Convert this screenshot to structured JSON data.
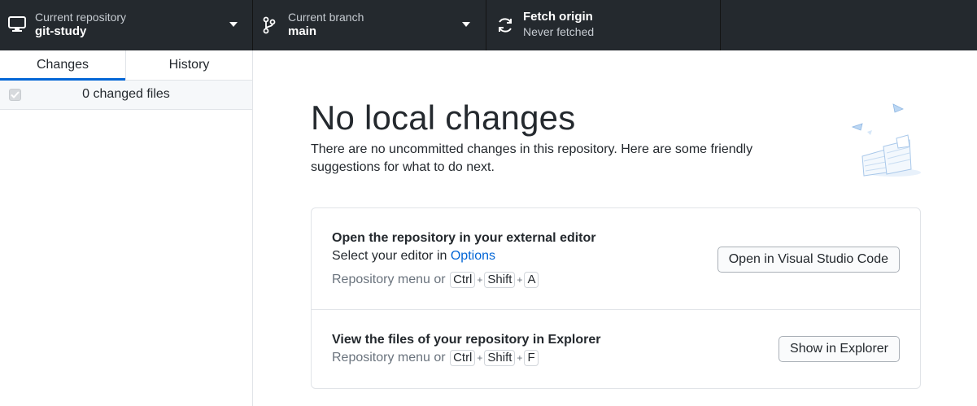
{
  "toolbar": {
    "repository": {
      "label": "Current repository",
      "value": "git-study"
    },
    "branch": {
      "label": "Current branch",
      "value": "main"
    },
    "fetch": {
      "label": "Fetch origin",
      "status": "Never fetched"
    }
  },
  "sidebar": {
    "tabs": [
      {
        "label": "Changes",
        "selected": true
      },
      {
        "label": "History",
        "selected": false
      }
    ],
    "changed_files_label": "0 changed files"
  },
  "main": {
    "title": "No local changes",
    "description": "There are no uncommitted changes in this repository. Here are some friendly suggestions for what to do next.",
    "suggestions": [
      {
        "title": "Open the repository in your external editor",
        "line_prefix": "Select your editor in ",
        "link": "Options",
        "hint_prefix": "Repository menu or ",
        "keys": [
          "Ctrl",
          "Shift",
          "A"
        ],
        "button": "Open in Visual Studio Code"
      },
      {
        "title": "View the files of your repository in Explorer",
        "hint_prefix": "Repository menu or ",
        "keys": [
          "Ctrl",
          "Shift",
          "F"
        ],
        "button": "Show in Explorer"
      }
    ]
  },
  "colors": {
    "toolbar_bg": "#24292e",
    "accent": "#0366d6",
    "border": "#e1e4e8"
  }
}
